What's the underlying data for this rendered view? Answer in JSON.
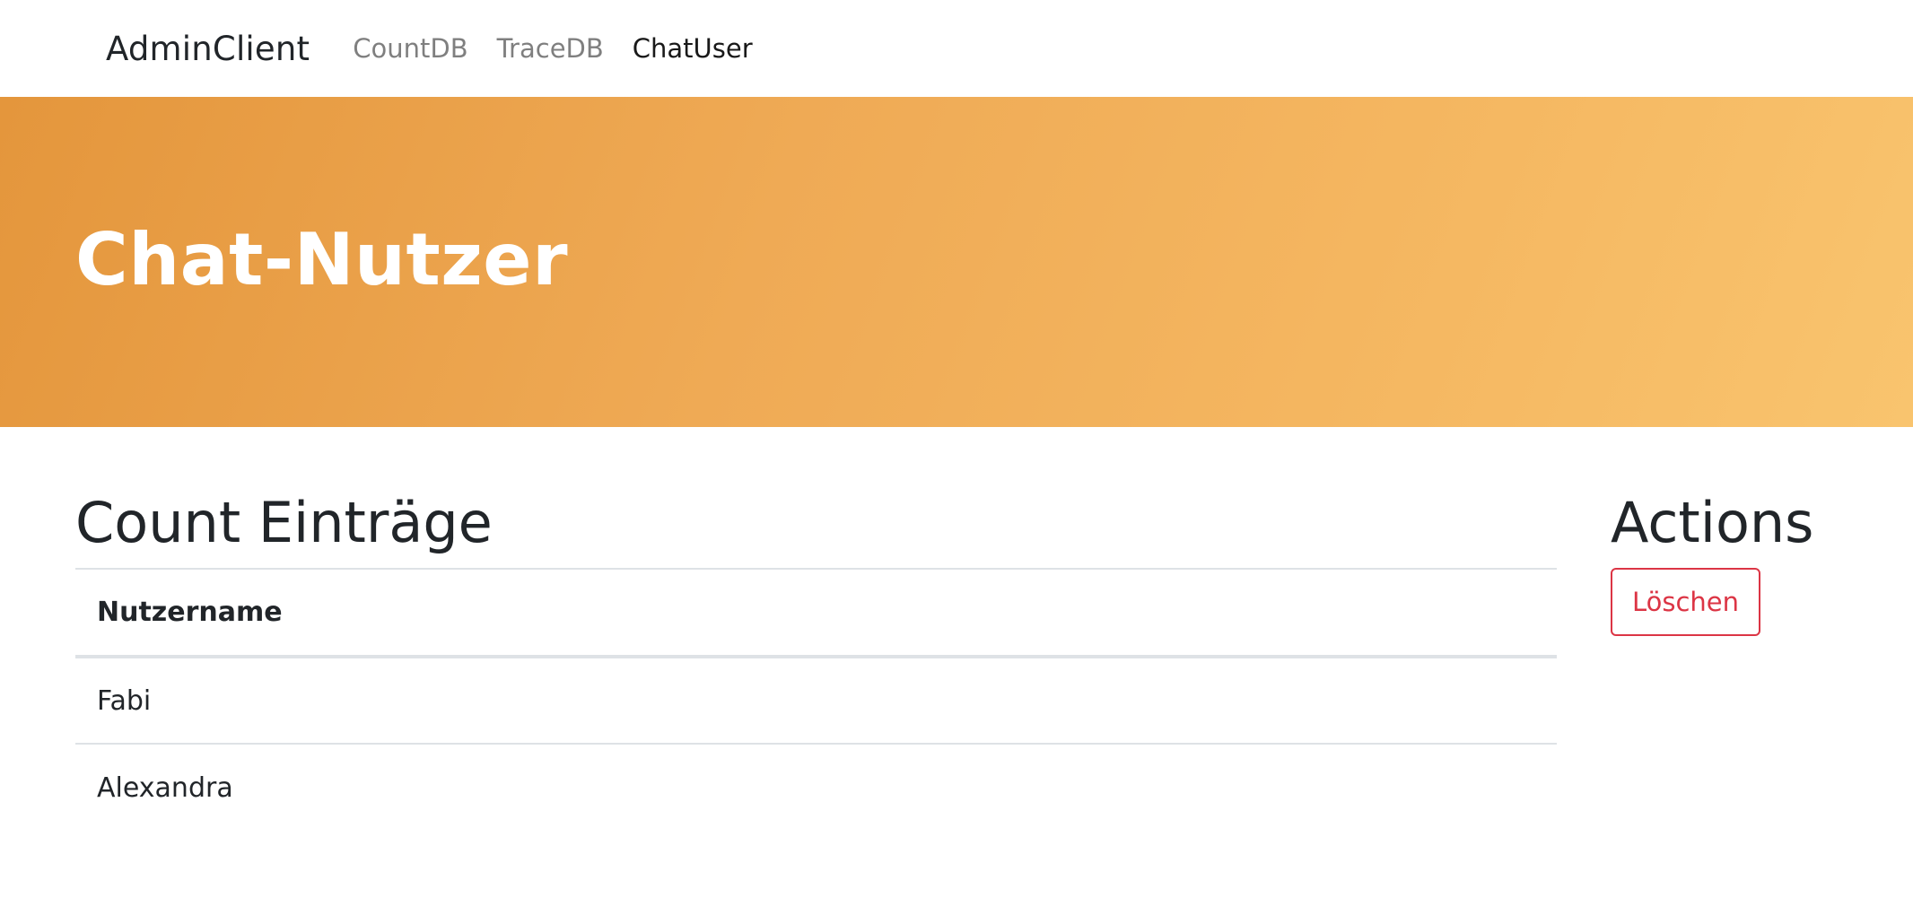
{
  "navbar": {
    "brand": "AdminClient",
    "links": [
      {
        "label": "CountDB",
        "active": false
      },
      {
        "label": "TraceDB",
        "active": false
      },
      {
        "label": "ChatUser",
        "active": true
      }
    ]
  },
  "hero": {
    "title": "Chat-Nutzer",
    "gradient_start": "#e4963c",
    "gradient_end": "#f9c46e"
  },
  "main": {
    "section_title": "Count Einträge",
    "table": {
      "columns": [
        "Nutzername"
      ],
      "rows": [
        [
          "Fabi"
        ],
        [
          "Alexandra"
        ]
      ]
    }
  },
  "actions": {
    "title": "Actions",
    "delete_label": "Löschen",
    "delete_color": "#dc3545"
  }
}
